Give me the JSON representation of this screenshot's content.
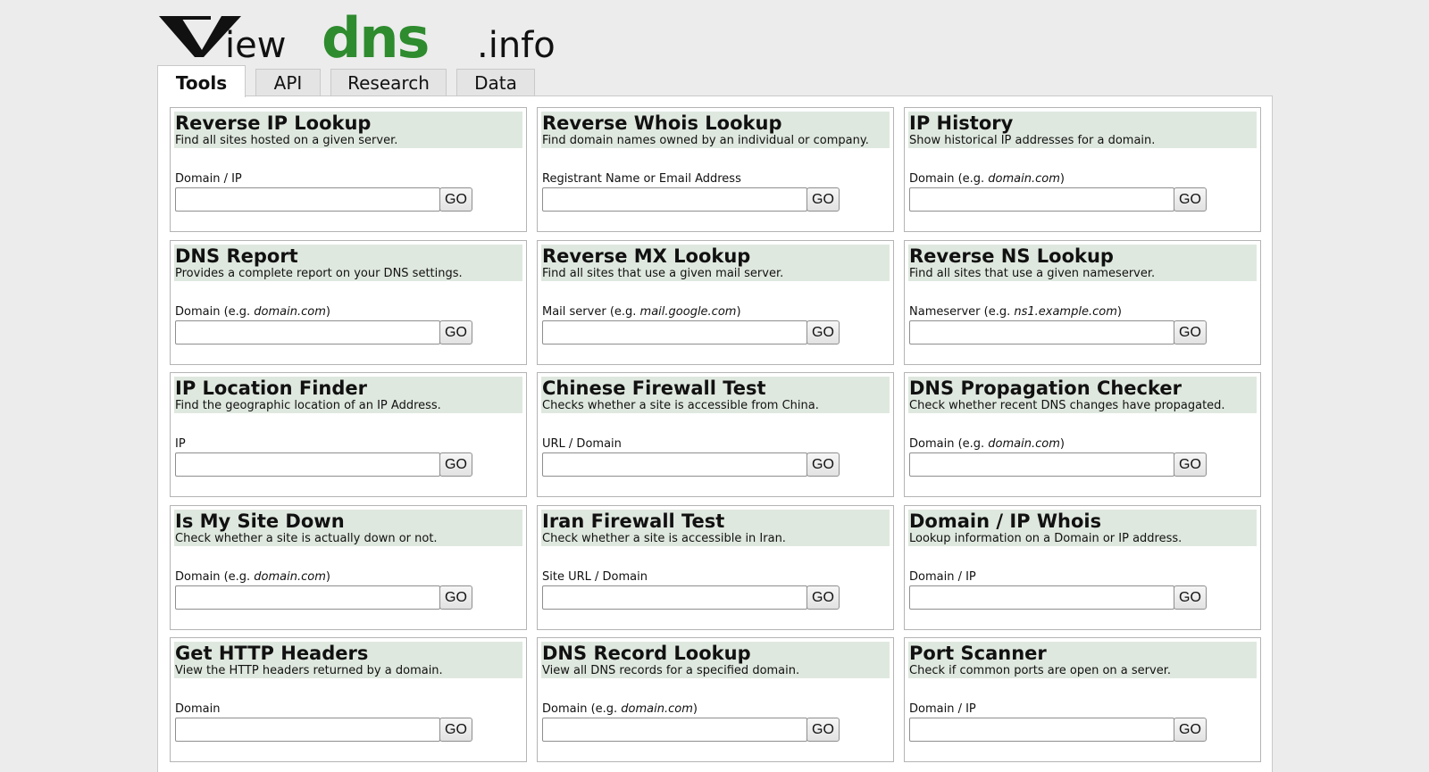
{
  "logo": {
    "part1": "View",
    "part2": "dns",
    "part3": ".info",
    "color_dark": "#111111",
    "color_green": "#2e8b2e"
  },
  "tabs": [
    {
      "label": "Tools",
      "active": true
    },
    {
      "label": "API",
      "active": false
    },
    {
      "label": "Research",
      "active": false
    },
    {
      "label": "Data",
      "active": false
    }
  ],
  "tools": [
    {
      "title": "Reverse IP Lookup",
      "desc": "Find all sites hosted on a given server.",
      "label": "Domain / IP",
      "example": "",
      "suffix": "",
      "button": "GO"
    },
    {
      "title": "Reverse Whois Lookup",
      "desc": "Find domain names owned by an individual or company.",
      "label": "Registrant Name or Email Address",
      "example": "",
      "suffix": "",
      "button": "GO"
    },
    {
      "title": "IP History",
      "desc": "Show historical IP addresses for a domain.",
      "label": "Domain (e.g. ",
      "example": "domain.com",
      "suffix": ")",
      "button": "GO"
    },
    {
      "title": "DNS Report",
      "desc": "Provides a complete report on your DNS settings.",
      "label": "Domain (e.g. ",
      "example": "domain.com",
      "suffix": ")",
      "button": "GO"
    },
    {
      "title": "Reverse MX Lookup",
      "desc": "Find all sites that use a given mail server.",
      "label": "Mail server (e.g. ",
      "example": "mail.google.com",
      "suffix": ")",
      "button": "GO"
    },
    {
      "title": "Reverse NS Lookup",
      "desc": "Find all sites that use a given nameserver.",
      "label": "Nameserver (e.g. ",
      "example": "ns1.example.com",
      "suffix": ")",
      "button": "GO"
    },
    {
      "title": "IP Location Finder",
      "desc": "Find the geographic location of an IP Address.",
      "label": "IP",
      "example": "",
      "suffix": "",
      "button": "GO"
    },
    {
      "title": "Chinese Firewall Test",
      "desc": "Checks whether a site is accessible from China.",
      "label": "URL / Domain",
      "example": "",
      "suffix": "",
      "button": "GO"
    },
    {
      "title": "DNS Propagation Checker",
      "desc": "Check whether recent DNS changes have propagated.",
      "label": "Domain (e.g. ",
      "example": "domain.com",
      "suffix": ")",
      "button": "GO"
    },
    {
      "title": "Is My Site Down",
      "desc": "Check whether a site is actually down or not.",
      "label": "Domain (e.g. ",
      "example": "domain.com",
      "suffix": ")",
      "button": "GO"
    },
    {
      "title": "Iran Firewall Test",
      "desc": "Check whether a site is accessible in Iran.",
      "label": "Site URL / Domain",
      "example": "",
      "suffix": "",
      "button": "GO"
    },
    {
      "title": "Domain / IP Whois",
      "desc": "Lookup information on a Domain or IP address.",
      "label": "Domain / IP",
      "example": "",
      "suffix": "",
      "button": "GO"
    },
    {
      "title": "Get HTTP Headers",
      "desc": "View the HTTP headers returned by a domain.",
      "label": "Domain",
      "example": "",
      "suffix": "",
      "button": "GO"
    },
    {
      "title": "DNS Record Lookup",
      "desc": "View all DNS records for a specified domain.",
      "label": "Domain (e.g. ",
      "example": "domain.com",
      "suffix": ")",
      "button": "GO"
    },
    {
      "title": "Port Scanner",
      "desc": "Check if common ports are open on a server.",
      "label": "Domain / IP",
      "example": "",
      "suffix": "",
      "button": "GO"
    }
  ],
  "colors": {
    "page_bg": "#ececec",
    "card_header_bg": "#dfe8df",
    "tab_bg": "#e4e4e4",
    "border": "#b4b4b4"
  }
}
